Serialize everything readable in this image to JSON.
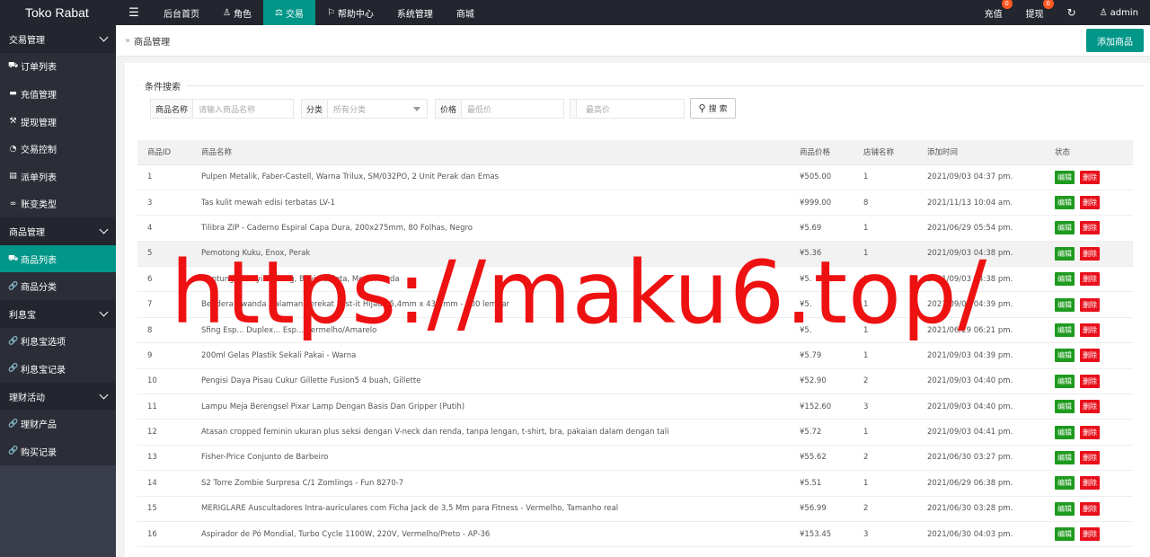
{
  "brand": "Toko Rabat",
  "topnav": {
    "items": [
      {
        "label": "后台首页",
        "icon": ""
      },
      {
        "label": "角色",
        "icon": "user-icon"
      },
      {
        "label": "交易",
        "icon": "scale-icon",
        "active": true
      },
      {
        "label": "帮助中心",
        "icon": "flag-icon"
      },
      {
        "label": "系统管理",
        "icon": ""
      },
      {
        "label": "商城",
        "icon": ""
      }
    ],
    "right": {
      "recharge": {
        "label": "充值",
        "badge": "0"
      },
      "withdraw": {
        "label": "提现",
        "badge": "0"
      },
      "user": "admin"
    }
  },
  "sidebar": {
    "groups": [
      {
        "label": "交易管理",
        "items": [
          {
            "label": "订单列表",
            "icon": "cart-icon"
          },
          {
            "label": "充值管理",
            "icon": "monitor-icon"
          },
          {
            "label": "提现管理",
            "icon": "hammer-icon"
          },
          {
            "label": "交易控制",
            "icon": "gauge-icon"
          },
          {
            "label": "派单列表",
            "icon": "briefcase-icon"
          },
          {
            "label": "账变类型",
            "icon": "infinity-icon"
          }
        ]
      },
      {
        "label": "商品管理",
        "items": [
          {
            "label": "商品列表",
            "icon": "cart-icon",
            "active": true
          },
          {
            "label": "商品分类",
            "icon": "link-icon"
          }
        ]
      },
      {
        "label": "利息宝",
        "items": [
          {
            "label": "利息宝选项",
            "icon": "link-icon"
          },
          {
            "label": "利息宝记录",
            "icon": "link-icon"
          }
        ]
      },
      {
        "label": "理财活动",
        "items": [
          {
            "label": "理财产品",
            "icon": "link-icon"
          },
          {
            "label": "购买记录",
            "icon": "link-icon"
          }
        ]
      }
    ]
  },
  "breadcrumb": "商品管理",
  "add_button": "添加商品",
  "search": {
    "legend": "条件搜索",
    "name_label": "商品名称",
    "name_placeholder": "请输入商品名称",
    "category_label": "分类",
    "category_value": "所有分类",
    "price_label": "价格",
    "min_placeholder": "最低价",
    "max_placeholder": "最高价",
    "button": "搜 索"
  },
  "table": {
    "headers": [
      "商品ID",
      "商品名称",
      "商品价格",
      "店铺名称",
      "添加时间",
      "状态"
    ],
    "edit_label": "编辑",
    "delete_label": "删除",
    "rows": [
      {
        "id": "1",
        "name": "Pulpen Metalik, Faber-Castell, Warna Trilux, SM/032PO, 2 Unit Perak dan Emas",
        "price": "¥505.00",
        "shop": "1",
        "time": "2021/09/03 04:37 pm."
      },
      {
        "id": "3",
        "name": "Tas kulit mewah edisi terbatas LV-1",
        "price": "¥999.00",
        "shop": "8",
        "time": "2021/11/13 10:04 am."
      },
      {
        "id": "4",
        "name": "Tilibra ZIP - Caderno Espiral Capa Dura, 200x275mm, 80 Folhas, Negro",
        "price": "¥5.69",
        "shop": "1",
        "time": "2021/06/29 05:54 pm."
      },
      {
        "id": "5",
        "name": "Pemotong Kuku, Enox, Perak",
        "price": "¥5.36",
        "shop": "1",
        "time": "2021/09/03 04:38 pm."
      },
      {
        "id": "6",
        "name": "Gantungan Bayi Bedong, Bayi Adoleta, Merah Muda",
        "price": "¥5.",
        "shop": "1",
        "time": "2021/09/03 04:38 pm."
      },
      {
        "id": "7",
        "name": "Bendera Rwanda Halaman Perekat Post-it Hijau 25,4mm x 43,2mm - 100 lembar",
        "price": "¥5.",
        "shop": "1",
        "time": "2021/09/03 04:39 pm."
      },
      {
        "id": "8",
        "name": "Sfing Esp... Duplex... Esp... Vermelho/Amarelo",
        "price": "¥5.",
        "shop": "1",
        "time": "2021/06/29 06:21 pm."
      },
      {
        "id": "9",
        "name": "200ml Gelas Plastik Sekali Pakai - Warna",
        "price": "¥5.79",
        "shop": "1",
        "time": "2021/09/03 04:39 pm."
      },
      {
        "id": "10",
        "name": "Pengisi Daya Pisau Cukur Gillette Fusion5 4 buah, Gillette",
        "price": "¥52.90",
        "shop": "2",
        "time": "2021/09/03 04:40 pm."
      },
      {
        "id": "11",
        "name": "Lampu Meja Berengsel Pixar Lamp Dengan Basis Dan Gripper (Putih)",
        "price": "¥152.60",
        "shop": "3",
        "time": "2021/09/03 04:40 pm."
      },
      {
        "id": "12",
        "name": "Atasan cropped feminin ukuran plus seksi dengan V-neck dan renda, tanpa lengan, t-shirt, bra, pakaian dalam dengan tali",
        "price": "¥5.72",
        "shop": "1",
        "time": "2021/09/03 04:41 pm."
      },
      {
        "id": "13",
        "name": "Fisher-Price Conjunto de Barbeiro",
        "price": "¥55.62",
        "shop": "2",
        "time": "2021/06/30 03:27 pm."
      },
      {
        "id": "14",
        "name": "S2 Torre Zombie Surpresa C/1 Zomlings - Fun 8270-7",
        "price": "¥5.51",
        "shop": "1",
        "time": "2021/06/29 06:38 pm."
      },
      {
        "id": "15",
        "name": "MERIGLARE Auscultadores Intra-auriculares com Ficha Jack de 3,5 Mm para Fitness - Vermelho, Tamanho real",
        "price": "¥56.99",
        "shop": "2",
        "time": "2021/06/30 03:28 pm."
      },
      {
        "id": "16",
        "name": "Aspirador de Pó Mondial, Turbo Cycle 1100W, 220V, Vermelho/Preto - AP-36",
        "price": "¥153.45",
        "shop": "3",
        "time": "2021/06/30 04:03 pm."
      }
    ]
  },
  "watermark": "https://maku6.top/",
  "colors": {
    "topbar": "#23262e",
    "accent": "#009688",
    "edit": "#1e9a1e",
    "delete": "#e8101b",
    "watermark": "#ee1111"
  }
}
